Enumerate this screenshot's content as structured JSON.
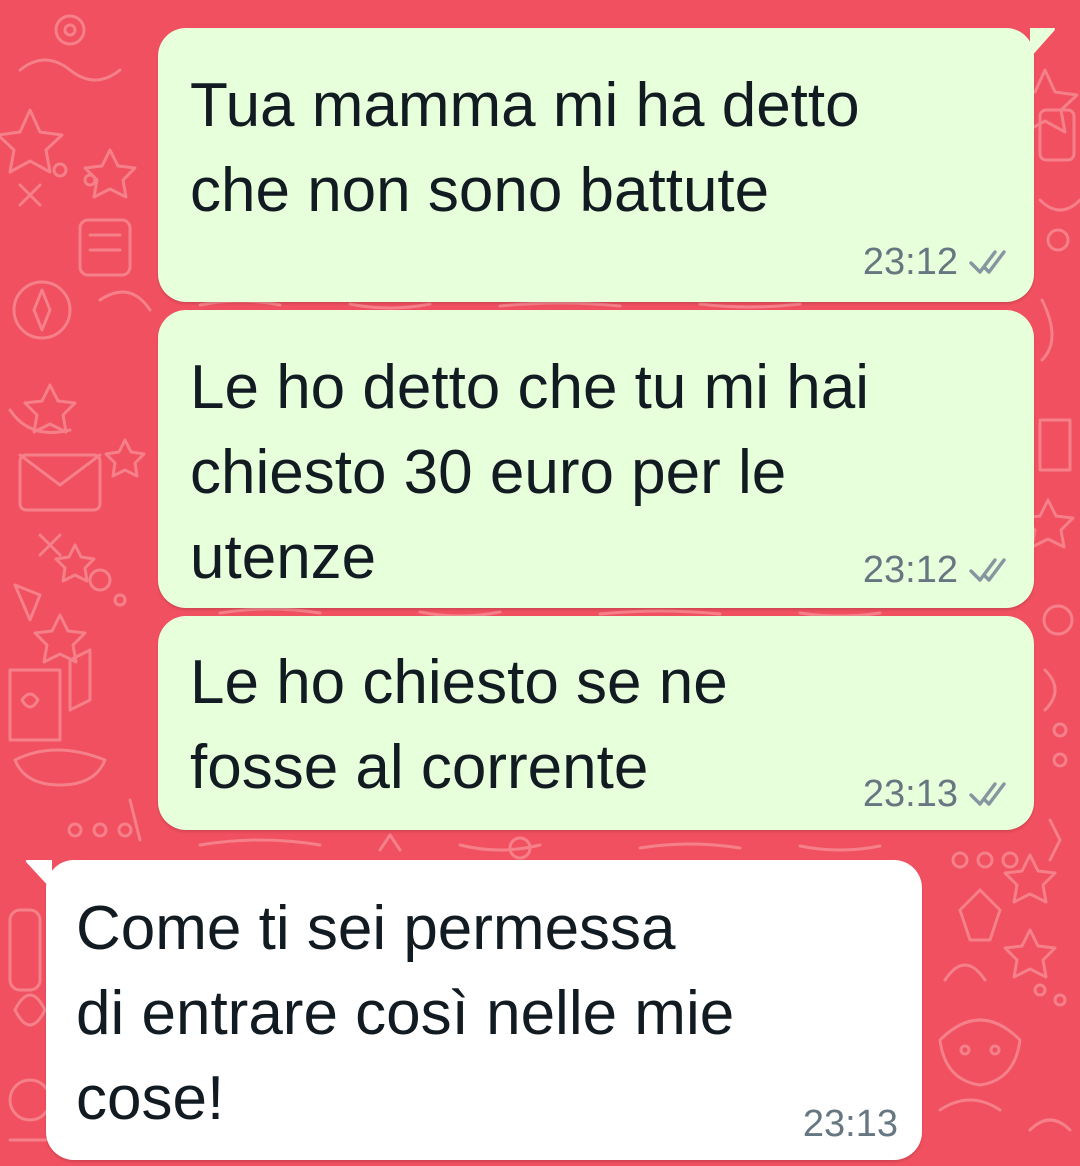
{
  "chat": {
    "messages": [
      {
        "direction": "outgoing",
        "text": "Tua mamma mi ha detto\nche non sono battute",
        "time": "23:12",
        "status_icon": "double-check-icon"
      },
      {
        "direction": "outgoing",
        "text": "Le ho detto che tu mi hai\nchiesto 30 euro per le\nutenze",
        "time": "23:12",
        "status_icon": "double-check-icon"
      },
      {
        "direction": "outgoing",
        "text": "Le ho chiesto se ne\nfosse al corrente",
        "time": "23:13",
        "status_icon": "double-check-icon"
      },
      {
        "direction": "incoming",
        "text": "Come ti sei permessa\ndi entrare così nelle mie\ncose!",
        "time": "23:13"
      }
    ]
  },
  "colors": {
    "background": "#f0505f",
    "doodle": "#f5808a",
    "outgoing_bubble": "#e7ffdb",
    "incoming_bubble": "#ffffff",
    "text": "#111b21",
    "meta_text": "#667781",
    "tick": "#8696a0"
  }
}
